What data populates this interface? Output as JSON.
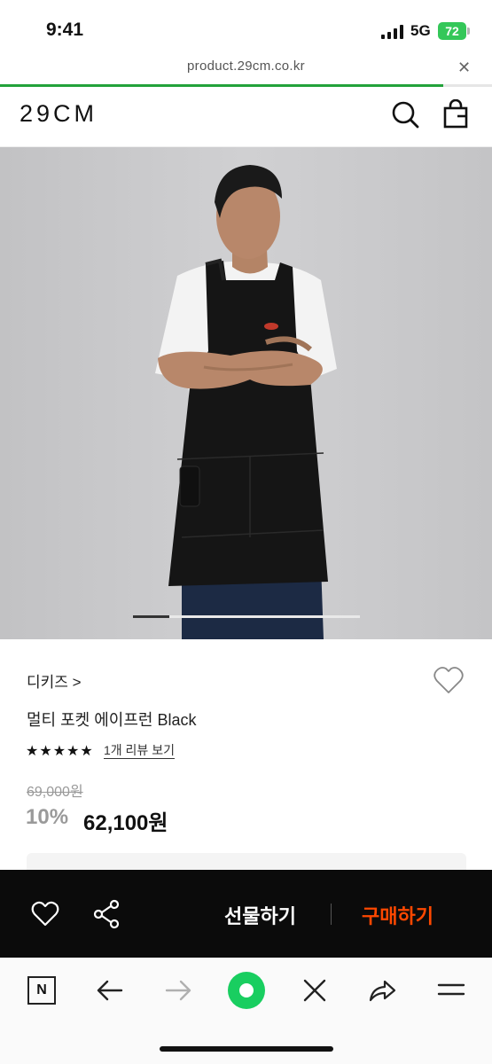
{
  "status_bar": {
    "time": "9:41",
    "network": "5G",
    "battery": "72"
  },
  "browser": {
    "url": "product.29cm.co.kr",
    "close_icon": "close-icon",
    "load_progress": 0.9
  },
  "header": {
    "logo": "29CM",
    "icons": [
      "search-icon",
      "shopping-bag-icon"
    ]
  },
  "gallery": {
    "image": "product-photo-apron",
    "current_index": 1,
    "indicator_fraction": 0.16
  },
  "product": {
    "brand": "디키즈 >",
    "name": "멀티 포켓 에이프런 Black",
    "stars": "★★★★★",
    "rating": 5,
    "review_link": "1개 리뷰 보기",
    "original_price": "69,000원",
    "discount": "10%",
    "sale_price": "62,100원"
  },
  "action_bar": {
    "gift_label": "선물하기",
    "buy_label": "구매하기",
    "buy_color": "#ff4800"
  },
  "toolbar": {
    "n_label": "N",
    "items": [
      "back-icon",
      "forward-icon",
      "home-icon",
      "close-icon",
      "share-icon",
      "menu-icon"
    ]
  }
}
